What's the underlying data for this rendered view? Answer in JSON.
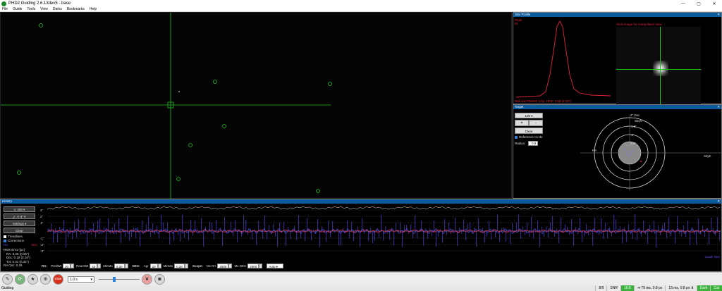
{
  "window": {
    "title": "PHD2 Guiding 2.6.13dev5 - base",
    "minimize": "—",
    "maximize": "▢",
    "close": "✕"
  },
  "menu": [
    "File",
    "Guide",
    "Tools",
    "View",
    "Darks",
    "Bookmarks",
    "Help"
  ],
  "star_profile": {
    "title": "Star Profile",
    "peak_label": "Peak",
    "peak_value": "61",
    "hint": "Click image for interpolated view",
    "fwhm_line": "Mid row FWHM: 2.61, HFD: 3.18 (3.23\")"
  },
  "target": {
    "title": "Target",
    "zoom_value": "100",
    "zoom_in": "+",
    "zoom_out": "-",
    "clear_label": "Clear",
    "ref_circle_label": "Reference Circle",
    "radius_label": "Radius:",
    "radius_value": "0.9",
    "axis_top": "2\" Dec",
    "axis_skyn": "SkyN",
    "axis_1_5": "1.5\"",
    "axis_1": "1\"",
    "axis_0_5": "0.5\"",
    "axis_ra": "RA",
    "axis_skye": "SkyE"
  },
  "history": {
    "title": "History",
    "x_scale": "x: 400",
    "y_scale": "y: +/-4\"",
    "settings_label": "Settings",
    "clear_label": "Clear",
    "trendlines_label": "Trendlines",
    "corrections_label": "Corrections",
    "ra_label": "RA",
    "dec_label": "Dec",
    "rms_title": "RMS Error [px]:",
    "rms_ra": "RA: 0.25 (0.26\")",
    "rms_dec": "Dec: 0.18 (0.18\")",
    "rms_tot": "Tot: 0.31 (0.32\")",
    "ra_osc": "RA Osc: 0.26",
    "y_labels": [
      "3\"",
      "2\"",
      "1\"",
      "-1\"",
      "-2\"",
      "-3\""
    ],
    "guide_star_label": "Guide Star",
    "ra_color": "#5a4ef0",
    "dec_color": "#e0233a"
  },
  "guide_controls": {
    "ra_label": "RA:",
    "ra_predwt_label": "PredWt",
    "ra_predwt": "20",
    "reactwt_label": "ReactWt",
    "reactwt": "42",
    "minmo_label": "MinMo",
    "minmo": "0.30",
    "dec_label": "DEC:",
    "agr_label": "Agr",
    "agr": "20",
    "dec_minmo_label": "MinMo",
    "dec_minmo": "0.30",
    "scope_label": "Scope:",
    "mxra_label": "Mx RA",
    "mxra": "2500",
    "mxdec_label": "Mx DEC",
    "mxdec": "2500",
    "mode": "Auto"
  },
  "toolbar": {
    "exposure": "1.0 s"
  },
  "status": {
    "left": "Guiding",
    "frame": "8/9",
    "snr_label": "SNR",
    "snr": "16.8",
    "ra_pulse": "79 ms, 0.8 px",
    "dec_pulse": "13 ms, 0.8 px",
    "dark": "Dark",
    "cal": "Cal"
  }
}
